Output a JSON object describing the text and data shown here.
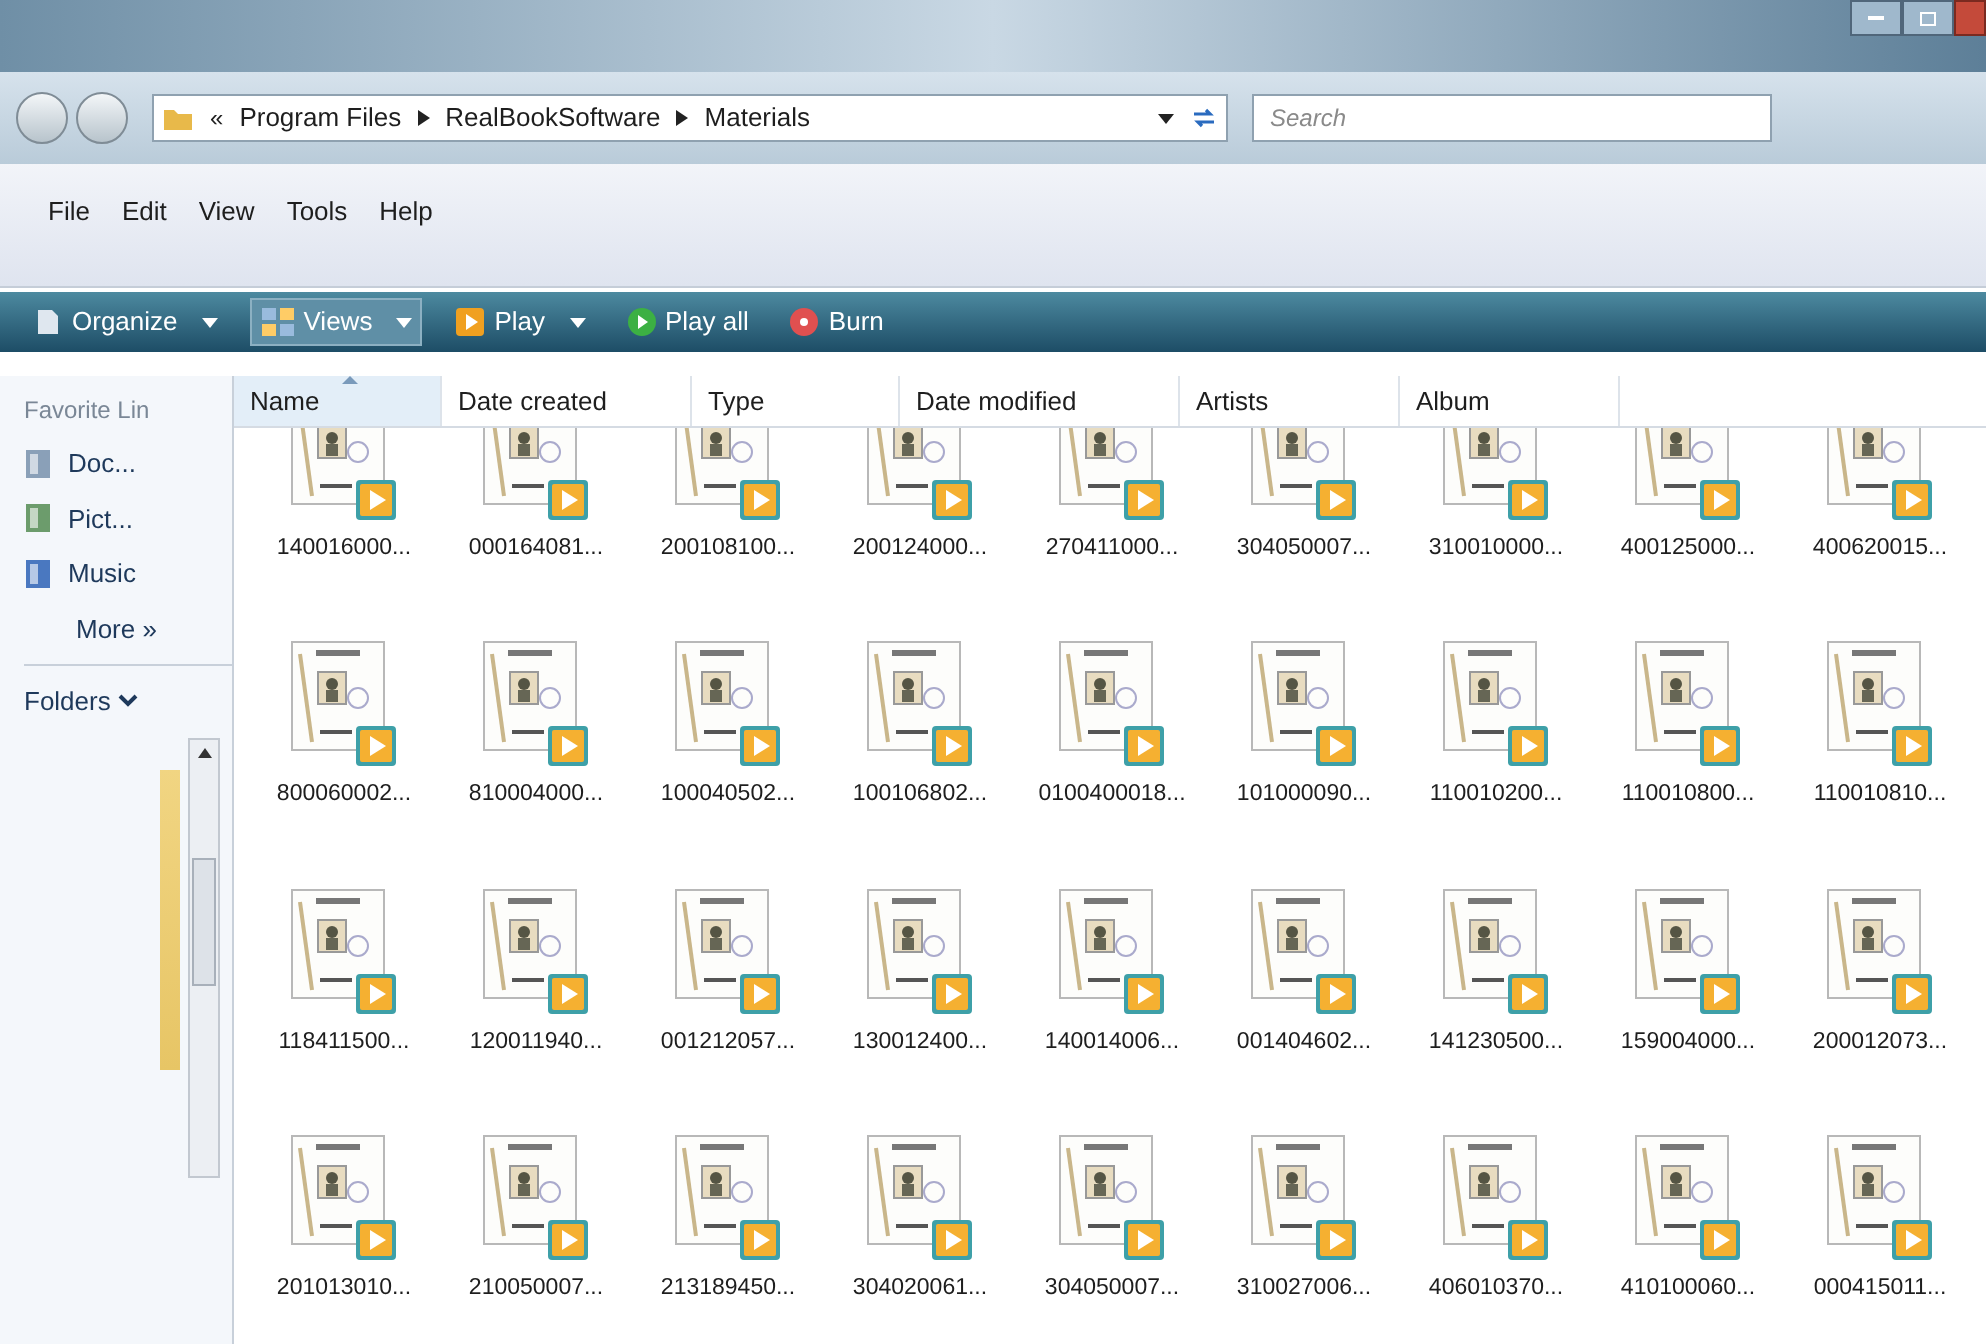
{
  "address_bar": {
    "overflow": "«",
    "path": [
      "Program Files",
      "RealBookSoftware",
      "Materials"
    ],
    "search_placeholder": "Search"
  },
  "menu_bar": [
    "File",
    "Edit",
    "View",
    "Tools",
    "Help"
  ],
  "toolbar": [
    {
      "kind": "organize",
      "label": "Organize",
      "dropdown": true
    },
    {
      "kind": "views",
      "label": "Views",
      "dropdown": true
    },
    {
      "kind": "play",
      "label": "Play",
      "dropdown": true
    },
    {
      "kind": "playall",
      "label": "Play all",
      "dropdown": false
    },
    {
      "kind": "burn",
      "label": "Burn",
      "dropdown": false
    }
  ],
  "sidebar": {
    "heading": "Favorite Lin",
    "links": [
      {
        "kind": "doc",
        "label": "Doc..."
      },
      {
        "kind": "pict",
        "label": "Pict..."
      },
      {
        "kind": "music",
        "label": "Music"
      }
    ],
    "more": "More »",
    "folders": "Folders"
  },
  "columns": [
    {
      "label": "Name",
      "sorted": true
    },
    {
      "label": "Date created",
      "sorted": false
    },
    {
      "label": "Type",
      "sorted": false
    },
    {
      "label": "Date modified",
      "sorted": false
    },
    {
      "label": "Artists",
      "sorted": false
    },
    {
      "label": "Album",
      "sorted": false
    }
  ],
  "files": [
    "140016000...",
    "000164081...",
    "200108100...",
    "200124000...",
    "270411000...",
    "304050007...",
    "310010000...",
    "400125000...",
    "400620015...",
    "800060002...",
    "810004000...",
    "100040502...",
    "100106802...",
    "0100400018...",
    "101000090...",
    "110010200...",
    "110010800...",
    "110010810...",
    "118411500...",
    "120011940...",
    "001212057...",
    "130012400...",
    "140014006...",
    "001404602...",
    "141230500...",
    "159004000...",
    "200012073...",
    "201013010...",
    "210050007...",
    "213189450...",
    "304020061...",
    "304050007...",
    "310027006...",
    "406010370...",
    "410100060...",
    "000415011..."
  ]
}
